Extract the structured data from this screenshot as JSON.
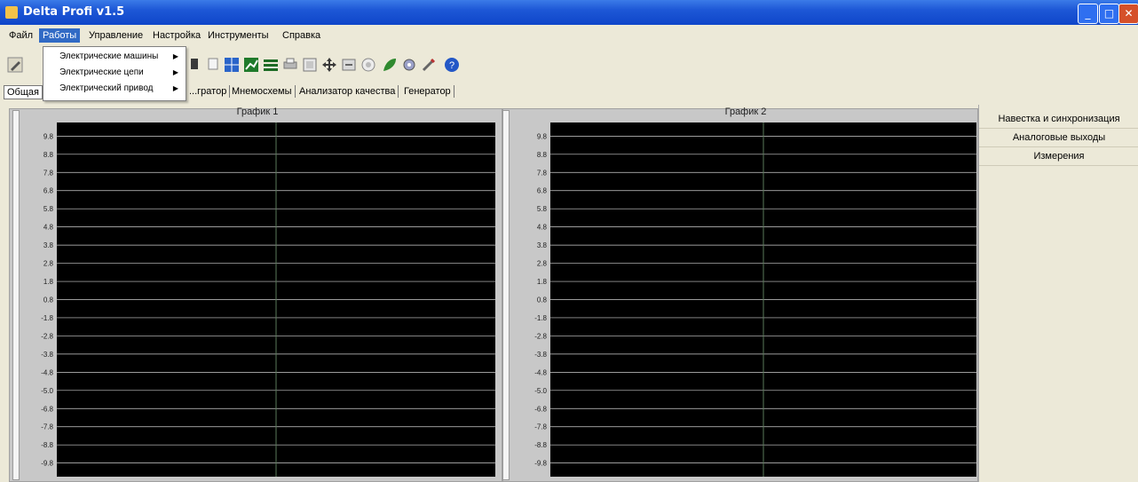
{
  "window": {
    "title": "Delta Profi v1.5",
    "buttons": {
      "minimize": "_",
      "maximize": "□",
      "close": "✕"
    }
  },
  "menu": {
    "items": [
      "Файл",
      "Работы",
      "Управление",
      "Настройка",
      "Инструменты",
      "Справка"
    ]
  },
  "dropdown": {
    "items": [
      {
        "label": "Электрические машины"
      },
      {
        "label": "Электрические цепи"
      },
      {
        "label": "Электрический привод"
      }
    ],
    "arrow": "▶"
  },
  "tabs": {
    "items": [
      "Общая",
      "...гратор",
      "Мнемосхемы",
      "Анализатор качества",
      "Генератор"
    ]
  },
  "charts": [
    {
      "title": "График 1"
    },
    {
      "title": "График 2"
    }
  ],
  "chart_data": [
    {
      "type": "line",
      "title": "График 1",
      "y_ticks": [
        "9.8",
        "8.8",
        "7.8",
        "6.8",
        "5.8",
        "4.8",
        "3.8",
        "2.8",
        "1.8",
        "0.8",
        "-1.8",
        "-2.8",
        "-3.8",
        "-4.8",
        "-5.0",
        "-6.8",
        "-7.8",
        "-8.8",
        "-9.8"
      ],
      "grid": true,
      "background": "#000000",
      "grid_color": "#d0d0d0",
      "series": []
    },
    {
      "type": "line",
      "title": "График 2",
      "y_ticks": [
        "9.8",
        "8.8",
        "7.8",
        "6.8",
        "5.8",
        "4.8",
        "3.8",
        "2.8",
        "1.8",
        "0.8",
        "-1.8",
        "-2.8",
        "-3.8",
        "-4.8",
        "-5.0",
        "-6.8",
        "-7.8",
        "-8.8",
        "-9.8"
      ],
      "grid": true,
      "background": "#000000",
      "grid_color": "#d0d0d0",
      "series": []
    }
  ],
  "right_panel": {
    "items": [
      "Навестка и синхронизация",
      "Аналоговые выходы",
      "Измерения"
    ]
  },
  "toolbar": {
    "icons": [
      "pencil-icon",
      "open-icon",
      "save-icon",
      "grid-icon",
      "chart-icon",
      "bars-icon",
      "print-icon",
      "page-icon",
      "move-icon",
      "frame-icon",
      "export-icon",
      "target-icon",
      "leaf-icon",
      "gear-icon",
      "tools-icon",
      "help-icon"
    ],
    "help_glyph": "?"
  },
  "colors": {
    "title_bar": "#1d57d6",
    "menu_active": "#316ac5",
    "plot_background": "#000000",
    "panel_background": "#ece9d8"
  }
}
